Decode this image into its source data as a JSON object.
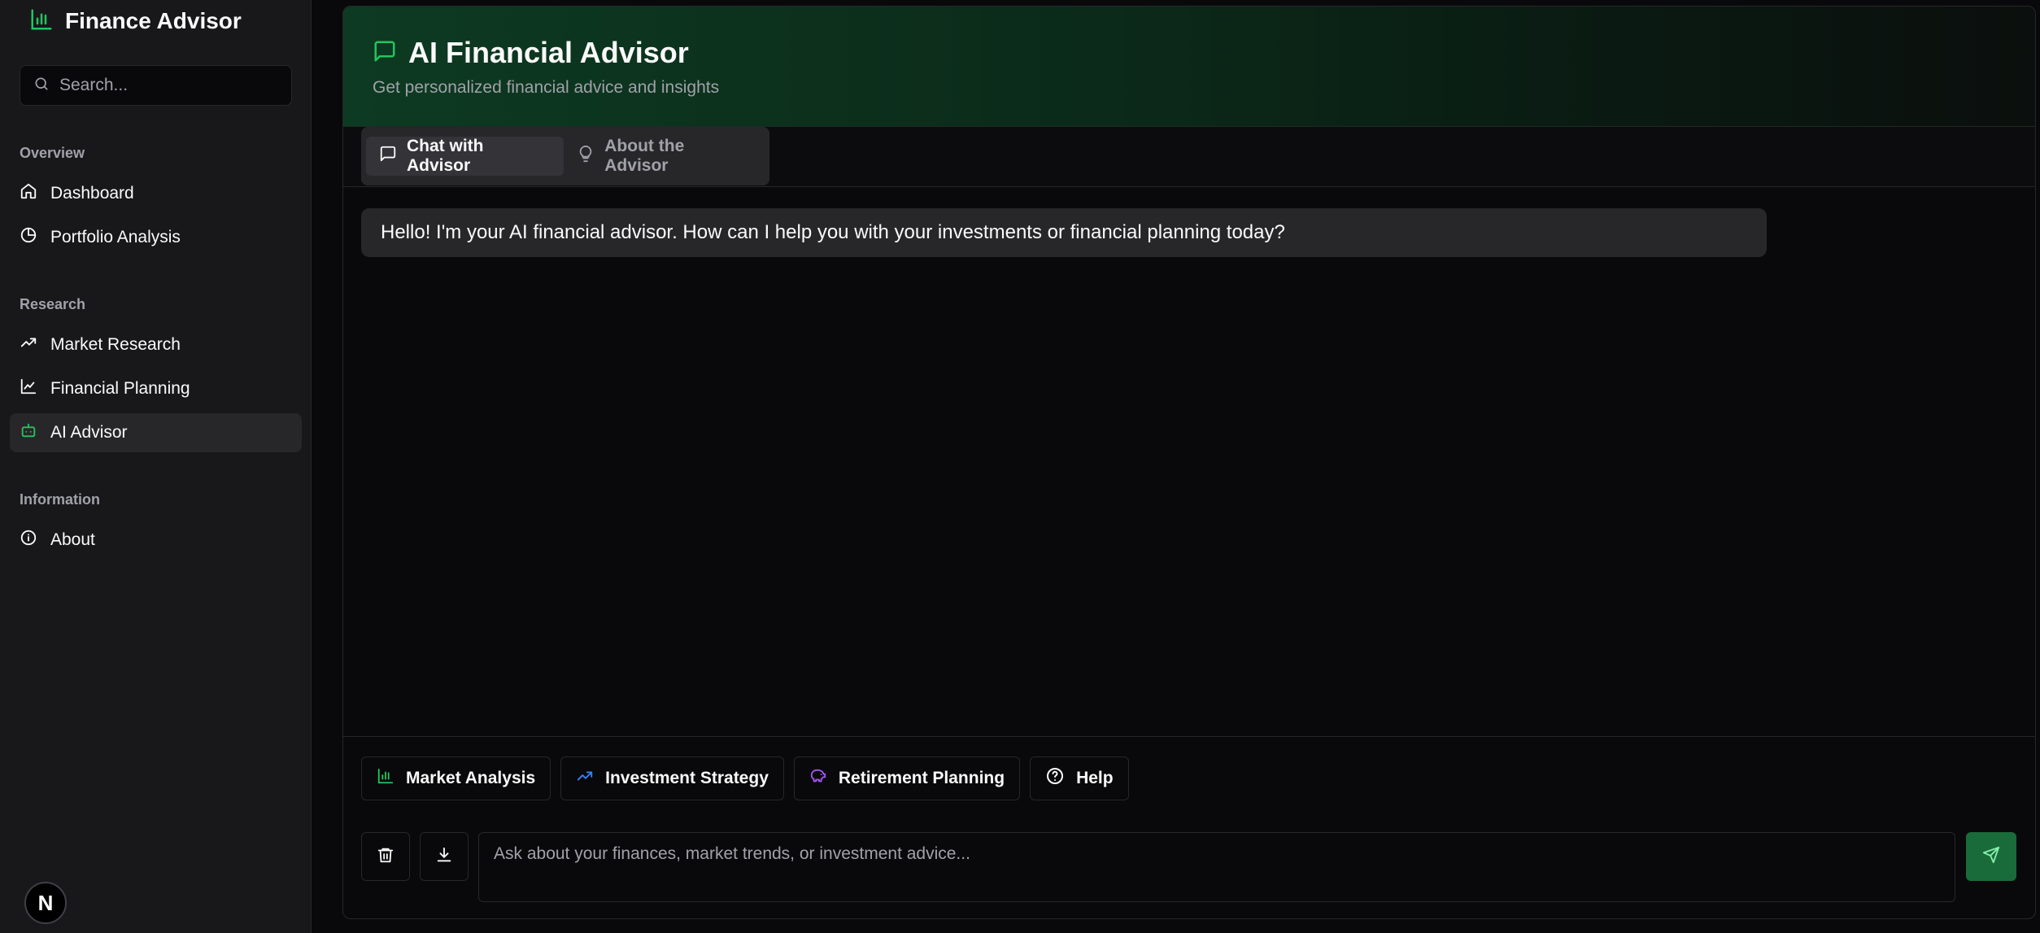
{
  "brand": {
    "title": "Finance Advisor"
  },
  "search": {
    "placeholder": "Search..."
  },
  "nav": {
    "groups": [
      {
        "label": "Overview",
        "items": [
          {
            "label": "Dashboard"
          },
          {
            "label": "Portfolio Analysis"
          }
        ]
      },
      {
        "label": "Research",
        "items": [
          {
            "label": "Market Research"
          },
          {
            "label": "Financial Planning"
          },
          {
            "label": "AI Advisor",
            "active": true
          }
        ]
      },
      {
        "label": "Information",
        "items": [
          {
            "label": "About"
          }
        ]
      }
    ]
  },
  "footer_logo": {
    "letter": "N"
  },
  "header": {
    "title": "AI Financial Advisor",
    "subtitle": "Get personalized financial advice and insights"
  },
  "tabs": [
    {
      "label": "Chat with Advisor",
      "active": true
    },
    {
      "label": "About the Advisor",
      "active": false
    }
  ],
  "messages": [
    {
      "role": "assistant",
      "text": "Hello! I'm your AI financial advisor. How can I help you with your investments or financial planning today?"
    }
  ],
  "quick_actions": [
    {
      "label": "Market Analysis",
      "icon": "bar-chart-icon",
      "color": "#22c55e"
    },
    {
      "label": "Investment Strategy",
      "icon": "trending-up-icon",
      "color": "#3b82f6"
    },
    {
      "label": "Retirement Planning",
      "icon": "piggy-bank-icon",
      "color": "#a855f7"
    },
    {
      "label": "Help",
      "icon": "help-circle-icon",
      "color": "#fafafa"
    }
  ],
  "composer": {
    "placeholder": "Ask about your finances, market trends, or investment advice..."
  },
  "colors": {
    "accent": "#22c55e",
    "send_button": "#1a6b3a",
    "background": "#09090b",
    "sidebar": "#18181b"
  }
}
